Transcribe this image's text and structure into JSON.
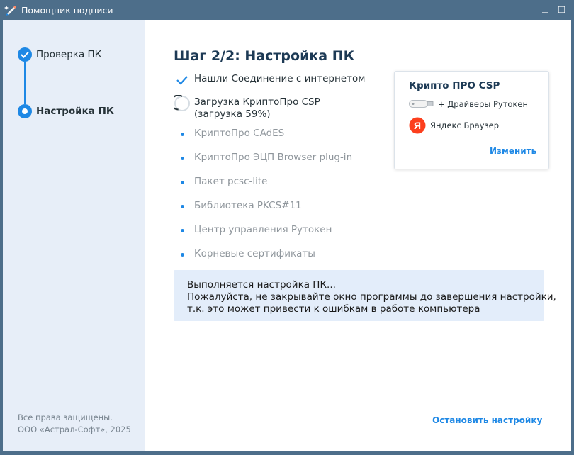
{
  "window": {
    "title": "Помощник подписи"
  },
  "sidebar": {
    "steps": [
      {
        "label": "Проверка ПК",
        "state": "done"
      },
      {
        "label": "Настройка ПК",
        "state": "current"
      }
    ],
    "copyright": [
      "Все права защищены.",
      "ООО «Астрал-Софт», 2025"
    ]
  },
  "main": {
    "heading": "Шаг 2/2: Настройка ПК",
    "tasks": [
      {
        "label": "Нашли Соединение с интернетом",
        "state": "done"
      },
      {
        "label": "Загрузка КриптоПро CSP",
        "sublabel": "(загрузка 59%)",
        "state": "in-progress",
        "progress_percent": 59
      },
      {
        "label": "КриптоПро CAdES",
        "state": "pending"
      },
      {
        "label": "КриптоПро ЭЦП Browser plug-in",
        "state": "pending"
      },
      {
        "label": "Пакет pcsc-lite",
        "state": "pending"
      },
      {
        "label": "Библиотека PKCS#11",
        "state": "pending"
      },
      {
        "label": "Центр управления Рутокен",
        "state": "pending"
      },
      {
        "label": "Корневые сертификаты",
        "state": "pending"
      }
    ],
    "info": {
      "lines": [
        "Выполняется настройка ПК...",
        "Пожалуйста, не закрывайте окно программы до завершения настройки,",
        "т.к. это может привести к ошибкам в работе компьютера"
      ]
    },
    "stop_label": "Остановить настройку"
  },
  "card": {
    "title": "Крипто ПРО CSP",
    "items": [
      {
        "label": "+ Драйверы Рутокен",
        "icon": "usb-token-icon"
      },
      {
        "label": "Яндекс Браузер",
        "icon": "yandex-icon",
        "icon_text": "Я"
      }
    ],
    "change_label": "Изменить"
  },
  "colors": {
    "accent": "#1e88e5",
    "titlebar": "#4d6e8a",
    "sidebar_bg": "#e7eef8",
    "info_bg": "#e3edfa",
    "yandex_red": "#fc3f1d"
  }
}
